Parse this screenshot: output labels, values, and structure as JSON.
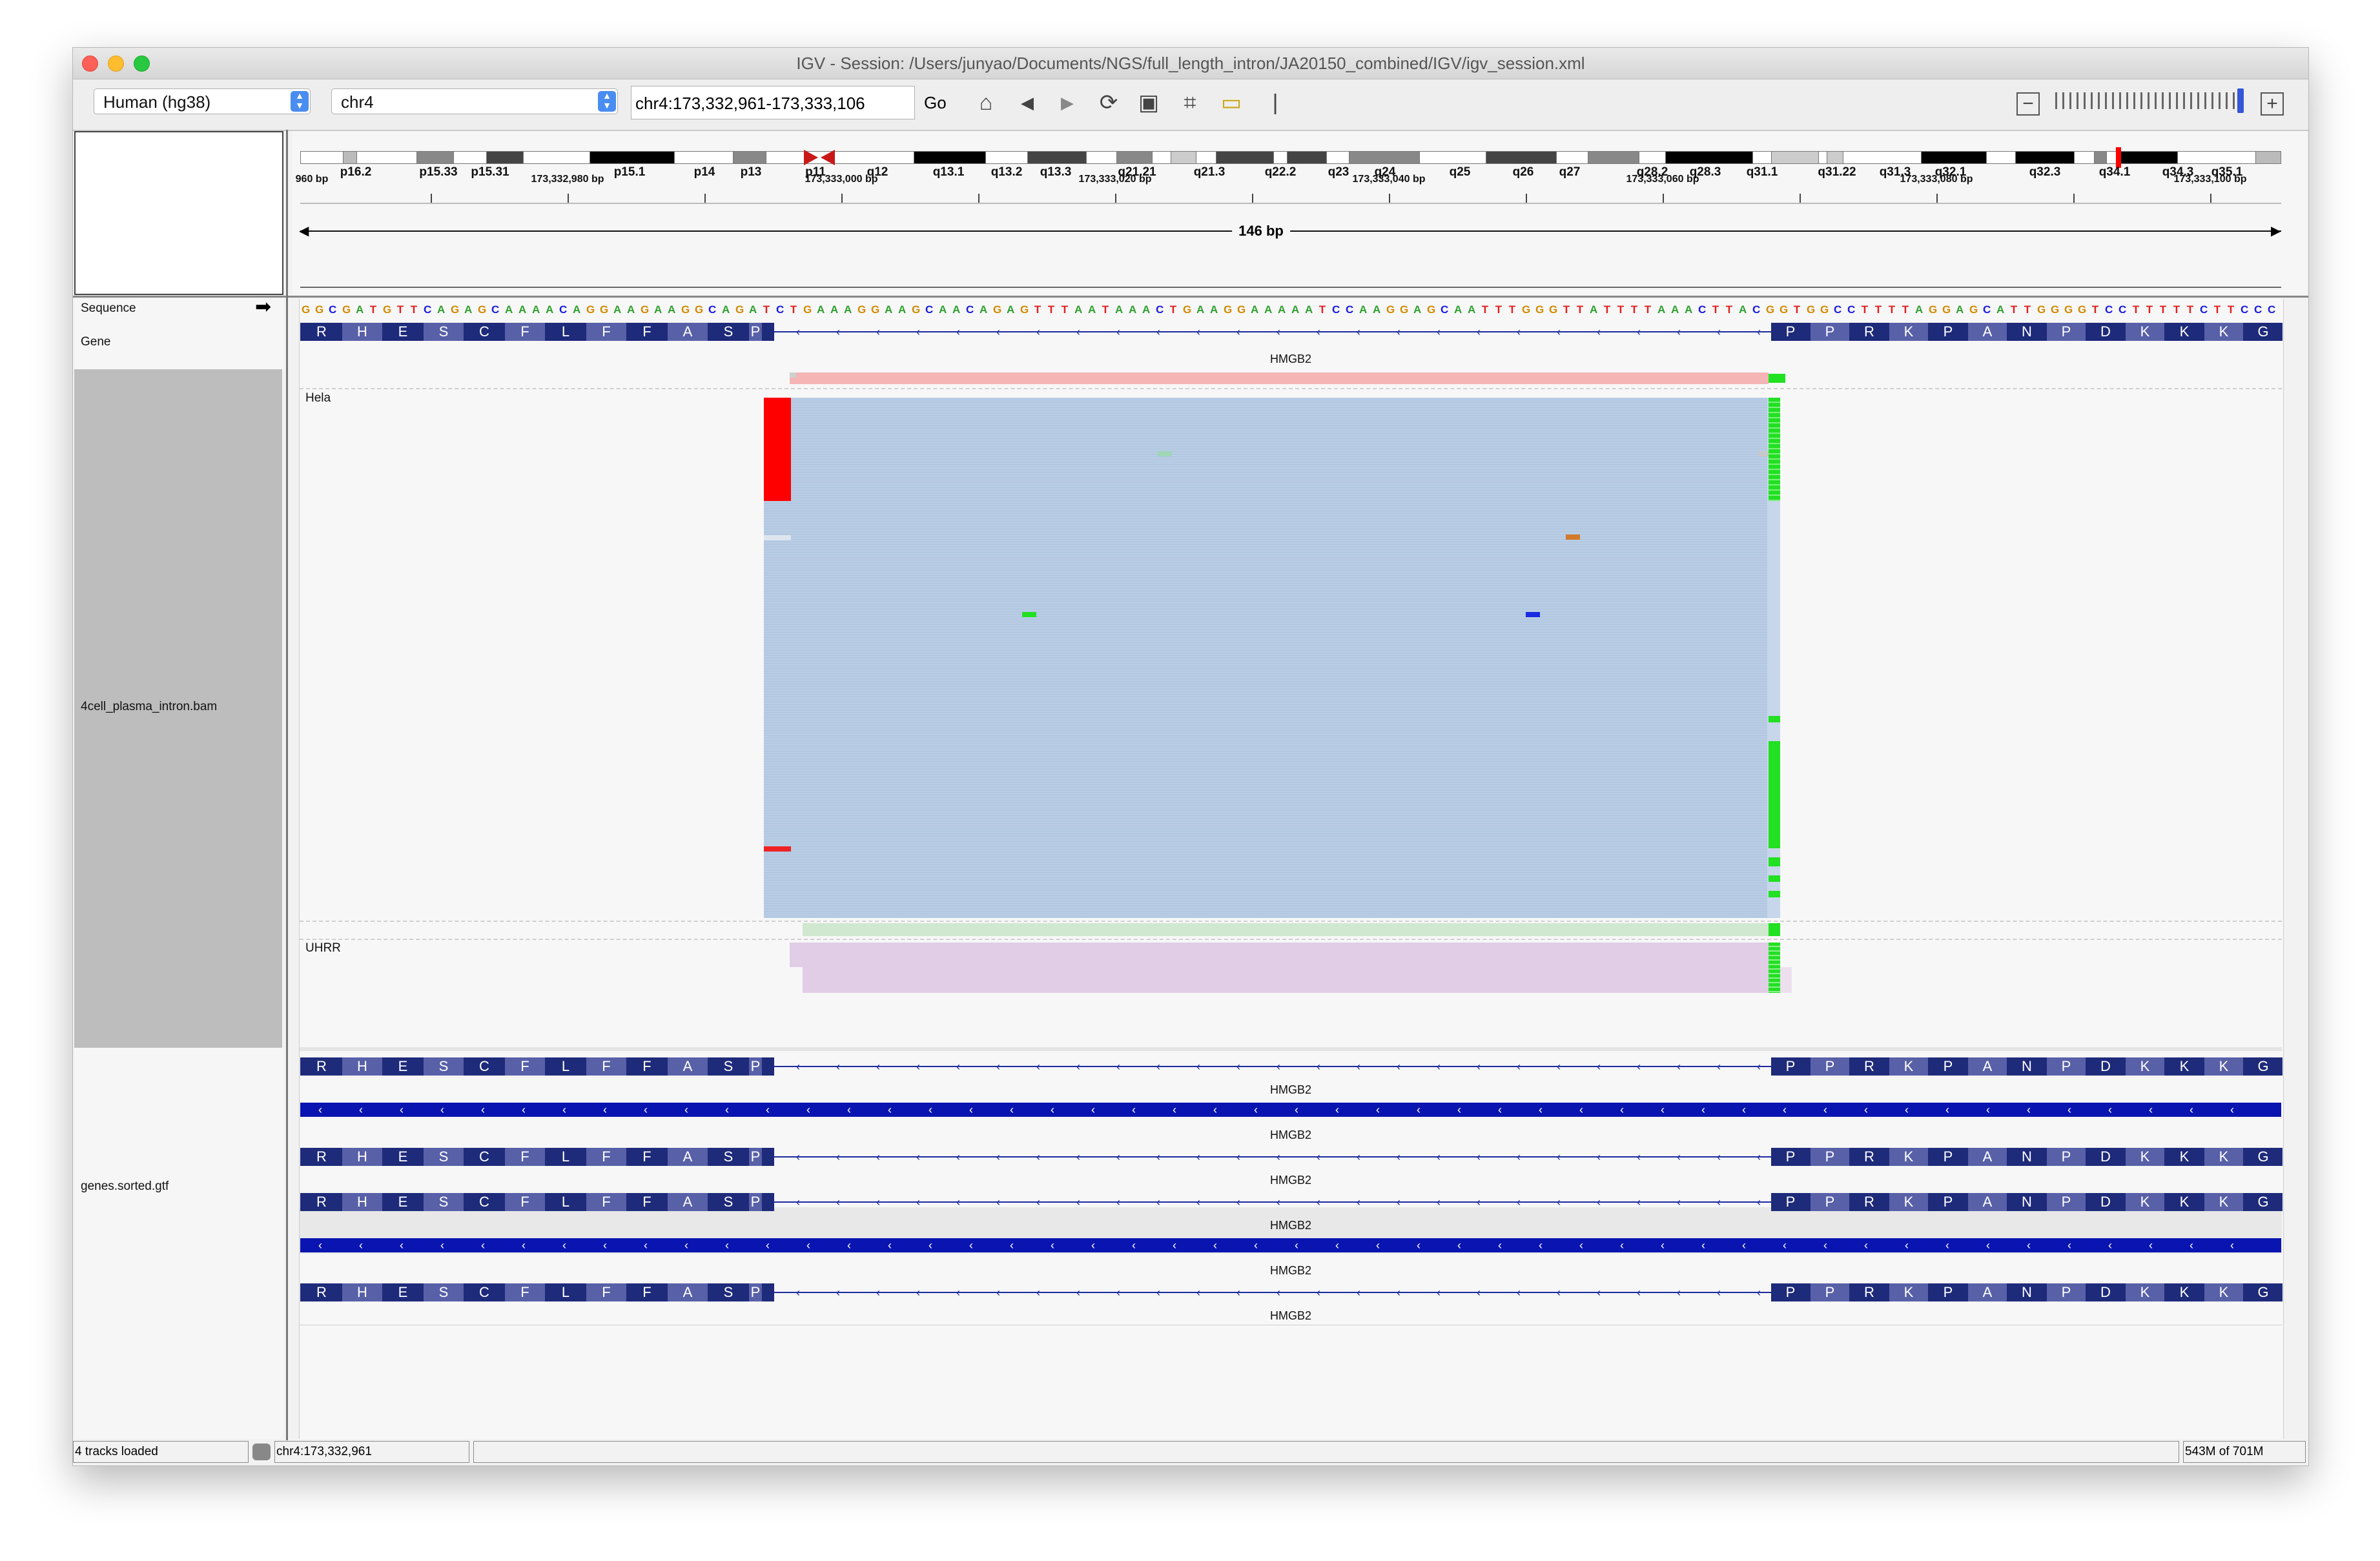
{
  "window": {
    "title": "IGV - Session: /Users/junyao/Documents/NGS/full_length_intron/JA20150_combined/IGV/igv_session.xml"
  },
  "toolbar": {
    "genome": "Human (hg38)",
    "chromosome": "chr4",
    "locus": "chr4:173,332,961-173,333,106",
    "go_label": "Go"
  },
  "ideogram": {
    "bands": [
      "p16.2",
      "p15.33",
      "p15.31",
      "p15.1",
      "p14",
      "p13",
      "p11",
      "q12",
      "q13.1",
      "q13.2",
      "q13.3",
      "q21.21",
      "q21.3",
      "q22.2",
      "q23",
      "q24",
      "q25",
      "q26",
      "q27",
      "q28.2",
      "q28.3",
      "q31.1",
      "q31.22",
      "q31.3",
      "q32.1",
      "q32.3",
      "q34.1",
      "q34.3",
      "q35.1"
    ]
  },
  "ruler": {
    "span": "146 bp",
    "left_label": "960 bp",
    "labels": [
      "173,332,980 bp",
      "173,333,000 bp",
      "173,333,020 bp",
      "173,333,040 bp",
      "173,333,060 bp",
      "173,333,080 bp",
      "173,333,100 bp"
    ]
  },
  "tracks": {
    "sequence": "Sequence",
    "gene": "Gene",
    "bam": "4cell_plasma_intron.bam",
    "gtf": "genes.sorted.gtf",
    "group_hela": "Hela",
    "group_uhrr": "UHRR"
  },
  "sequence": "GGCGATGTTCAGAGCAAAACAGGAAGAAGGCAGATCTGAAAGGAAGCAACAGAGTTTAATAAACTGAAGGAAAAATCCAAGGAGCAATTTGGGTTATTTTAAACTTACGGTGGCCTTTTAGGAGCATTGGGGTCCTTTTTCTTCCC",
  "gene": {
    "name": "HMGB2",
    "left_aa": [
      "R",
      "H",
      "E",
      "S",
      "C",
      "F",
      "L",
      "F",
      "F",
      "A",
      "S",
      "P"
    ],
    "right_aa": [
      "P",
      "P",
      "R",
      "K",
      "P",
      "A",
      "N",
      "P",
      "D",
      "K",
      "K",
      "K",
      "G"
    ]
  },
  "status": {
    "tracks_loaded": "4 tracks loaded",
    "position": "chr4:173,332,961",
    "memory": "543M of 701M"
  },
  "colors": {
    "A": "#2fa02f",
    "C": "#1a1adf",
    "G": "#d18a00",
    "T": "#e02020",
    "exon": "#1e2a7a",
    "read": "#b8cce4",
    "hela_coverage": "#f5b5b5",
    "uhrr_coverage": "#cfe8cf",
    "uhrr_read": "#e1cde6"
  }
}
